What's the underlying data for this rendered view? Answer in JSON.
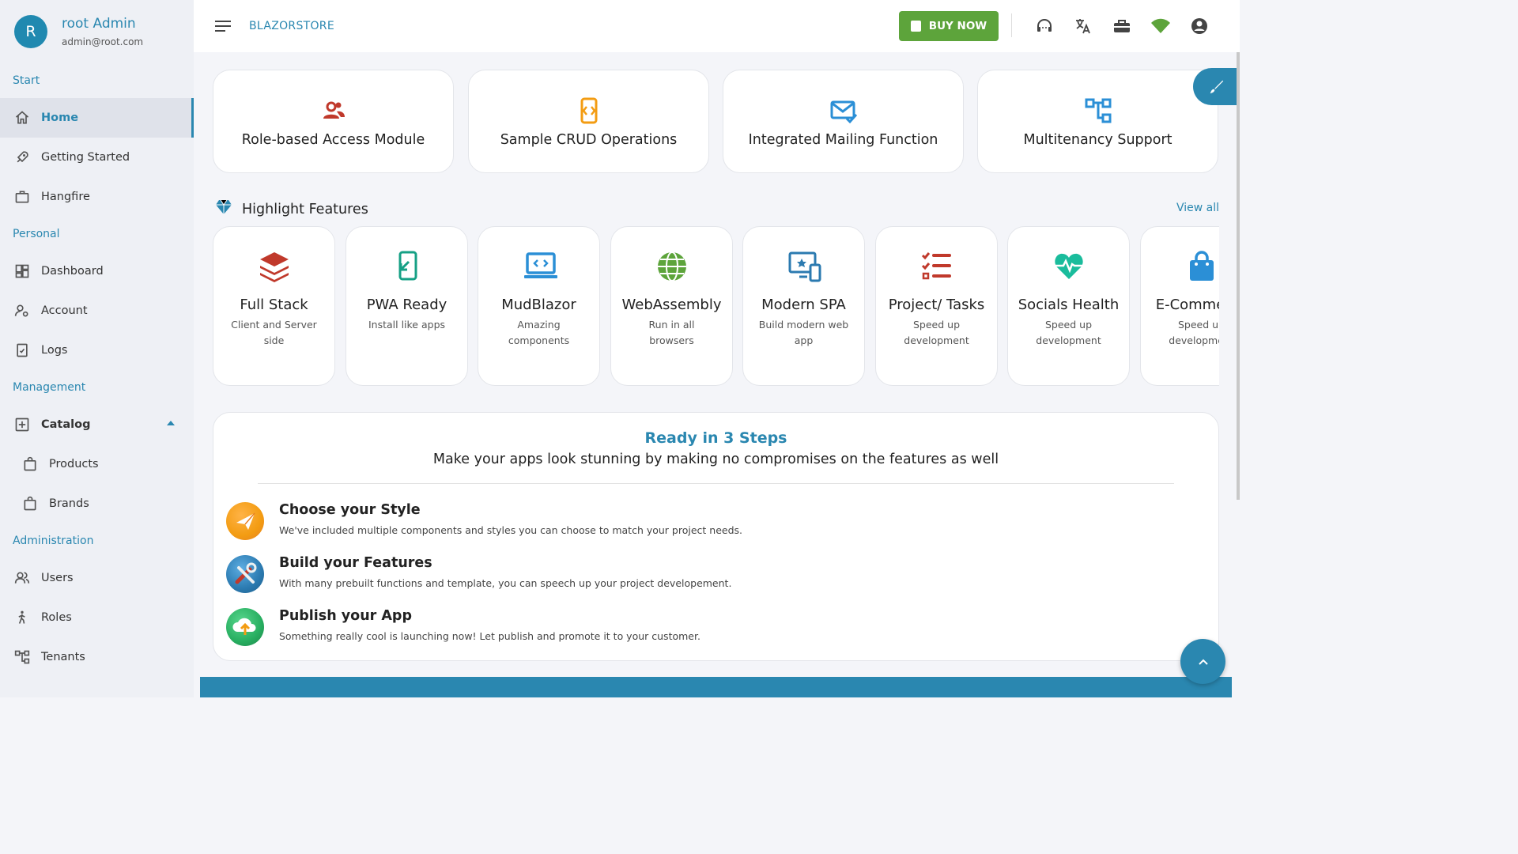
{
  "profile": {
    "initial": "R",
    "name": "root Admin",
    "email": "admin@root.com"
  },
  "sidebar": {
    "sections": [
      "Start",
      "Personal",
      "Management",
      "Administration"
    ],
    "items": {
      "home": "Home",
      "getting_started": "Getting Started",
      "hangfire": "Hangfire",
      "dashboard": "Dashboard",
      "account": "Account",
      "logs": "Logs",
      "catalog": "Catalog",
      "products": "Products",
      "brands": "Brands",
      "users": "Users",
      "roles": "Roles",
      "tenants": "Tenants"
    }
  },
  "topbar": {
    "brand": "BLAZORSTORE",
    "buy_now": "BUY NOW"
  },
  "top_cards": [
    {
      "label": "Role-based Access Module",
      "icon": "users-icon",
      "color": "#c0392b"
    },
    {
      "label": "Sample CRUD Operations",
      "icon": "code-brackets-icon",
      "color": "#f39c12"
    },
    {
      "label": "Integrated Mailing Function",
      "icon": "mail-check-icon",
      "color": "#2b8fd6"
    },
    {
      "label": "Multitenancy Support",
      "icon": "hierarchy-icon",
      "color": "#2b8fd6"
    }
  ],
  "highlight": {
    "title": "Highlight Features",
    "view_all": "View all"
  },
  "features": [
    {
      "title": "Full Stack",
      "sub": "Client and Server side",
      "icon": "layers-icon",
      "color": "#c0392b"
    },
    {
      "title": "PWA Ready",
      "sub": "Install like apps",
      "icon": "install-icon",
      "color": "#16a085"
    },
    {
      "title": "MudBlazor",
      "sub": "Amazing components",
      "icon": "laptop-code-icon",
      "color": "#2b8fd6"
    },
    {
      "title": "WebAssembly",
      "sub": "Run in all browsers",
      "icon": "globe-icon",
      "color": "#5da43b"
    },
    {
      "title": "Modern SPA",
      "sub": "Build modern web app",
      "icon": "devices-icon",
      "color": "#2b7ab0"
    },
    {
      "title": "Project/ Tasks",
      "sub": "Speed up development",
      "icon": "checklist-icon",
      "color": "#c0392b"
    },
    {
      "title": "Socials Health",
      "sub": "Speed up development",
      "icon": "heartbeat-icon",
      "color": "#1abc9c"
    },
    {
      "title": "E-Commerce",
      "sub": "Speed up development",
      "icon": "shopping-bag-icon",
      "color": "#2b8fd6"
    }
  ],
  "steps": {
    "title": "Ready in 3 Steps",
    "subtitle": "Make your apps look stunning by making no compromises on the features as well",
    "items": [
      {
        "title": "Choose your Style",
        "desc": "We've included multiple components and styles you can choose to match your project needs.",
        "icon": "paper-plane-icon",
        "color": "#f39c12"
      },
      {
        "title": "Build your Features",
        "desc": "With many prebuilt functions and template, you can speech up your project developement.",
        "icon": "tools-icon",
        "color": "#2b7ab0"
      },
      {
        "title": "Publish your App",
        "desc": "Something really cool is launching now! Let publish and promote it to your customer.",
        "icon": "cloud-upload-icon",
        "color": "#27ae60"
      }
    ]
  }
}
